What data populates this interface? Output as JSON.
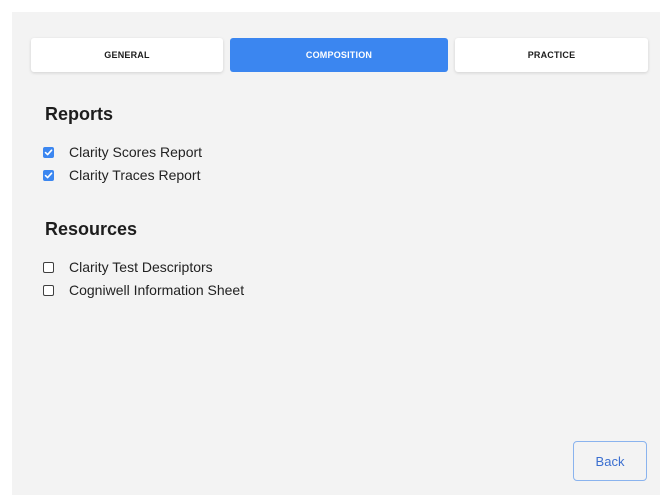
{
  "tabs": [
    {
      "label": "GENERAL",
      "active": false
    },
    {
      "label": "COMPOSITION",
      "active": true
    },
    {
      "label": "PRACTICE",
      "active": false
    }
  ],
  "reports": {
    "title": "Reports",
    "items": [
      {
        "label": "Clarity Scores Report",
        "checked": true
      },
      {
        "label": "Clarity Traces Report",
        "checked": true
      }
    ]
  },
  "resources": {
    "title": "Resources",
    "items": [
      {
        "label": "Clarity Test Descriptors",
        "checked": false
      },
      {
        "label": "Cogniwell Information Sheet",
        "checked": false
      }
    ]
  },
  "footer": {
    "back_label": "Back"
  },
  "colors": {
    "accent": "#3b86f0",
    "panel_background": "#f3f3f3",
    "text": "#222222"
  }
}
